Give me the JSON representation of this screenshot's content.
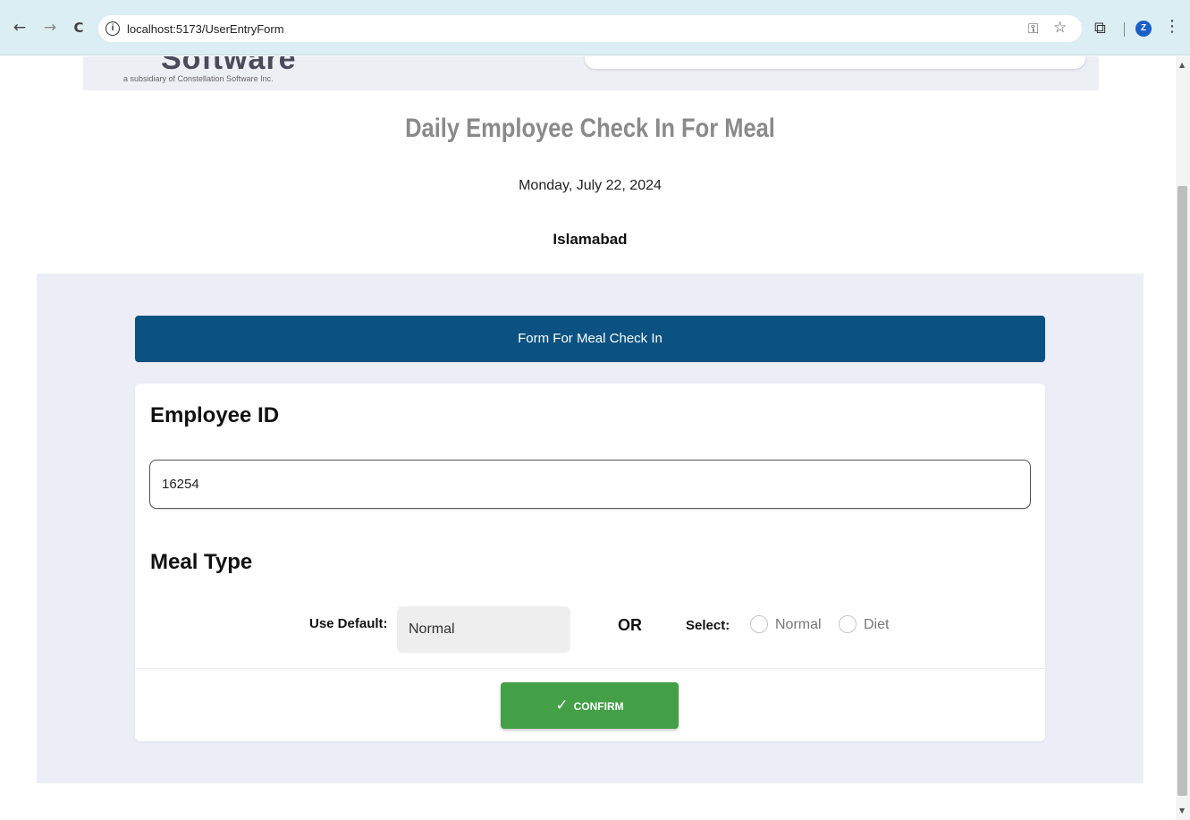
{
  "browser": {
    "back_icon": "←",
    "forward_icon": "→",
    "reload_icon": "C",
    "site_info_icon": "i",
    "url": "localhost:5173/UserEntryForm",
    "key_icon": "⚿",
    "star_icon": "☆",
    "extensions_icon": "⧉",
    "profile_initial": "Z",
    "menu_icon": "⋮"
  },
  "header": {
    "logo_word": "Software",
    "logo_tagline": "a subsidiary of Constellation Software Inc."
  },
  "page": {
    "title": "Daily Employee Check In For Meal",
    "date": "Monday, July 22, 2024",
    "location": "Islamabad"
  },
  "form": {
    "header": "Form For Meal Check In",
    "employee_id_label": "Employee ID",
    "employee_id_value": "16254",
    "meal_type_label": "Meal Type",
    "use_default_label": "Use Default:",
    "default_meal": "Normal",
    "or_label": "OR",
    "select_label": "Select:",
    "options": [
      "Normal",
      "Diet"
    ],
    "confirm_label": "CONFIRM",
    "confirm_icon": "✓"
  },
  "scrollbar": {
    "up_icon": "▲",
    "down_icon": "▼"
  },
  "colors": {
    "form_header_bg": "#0b5282",
    "confirm_bg": "#43a047",
    "section_bg": "#ededf7"
  }
}
